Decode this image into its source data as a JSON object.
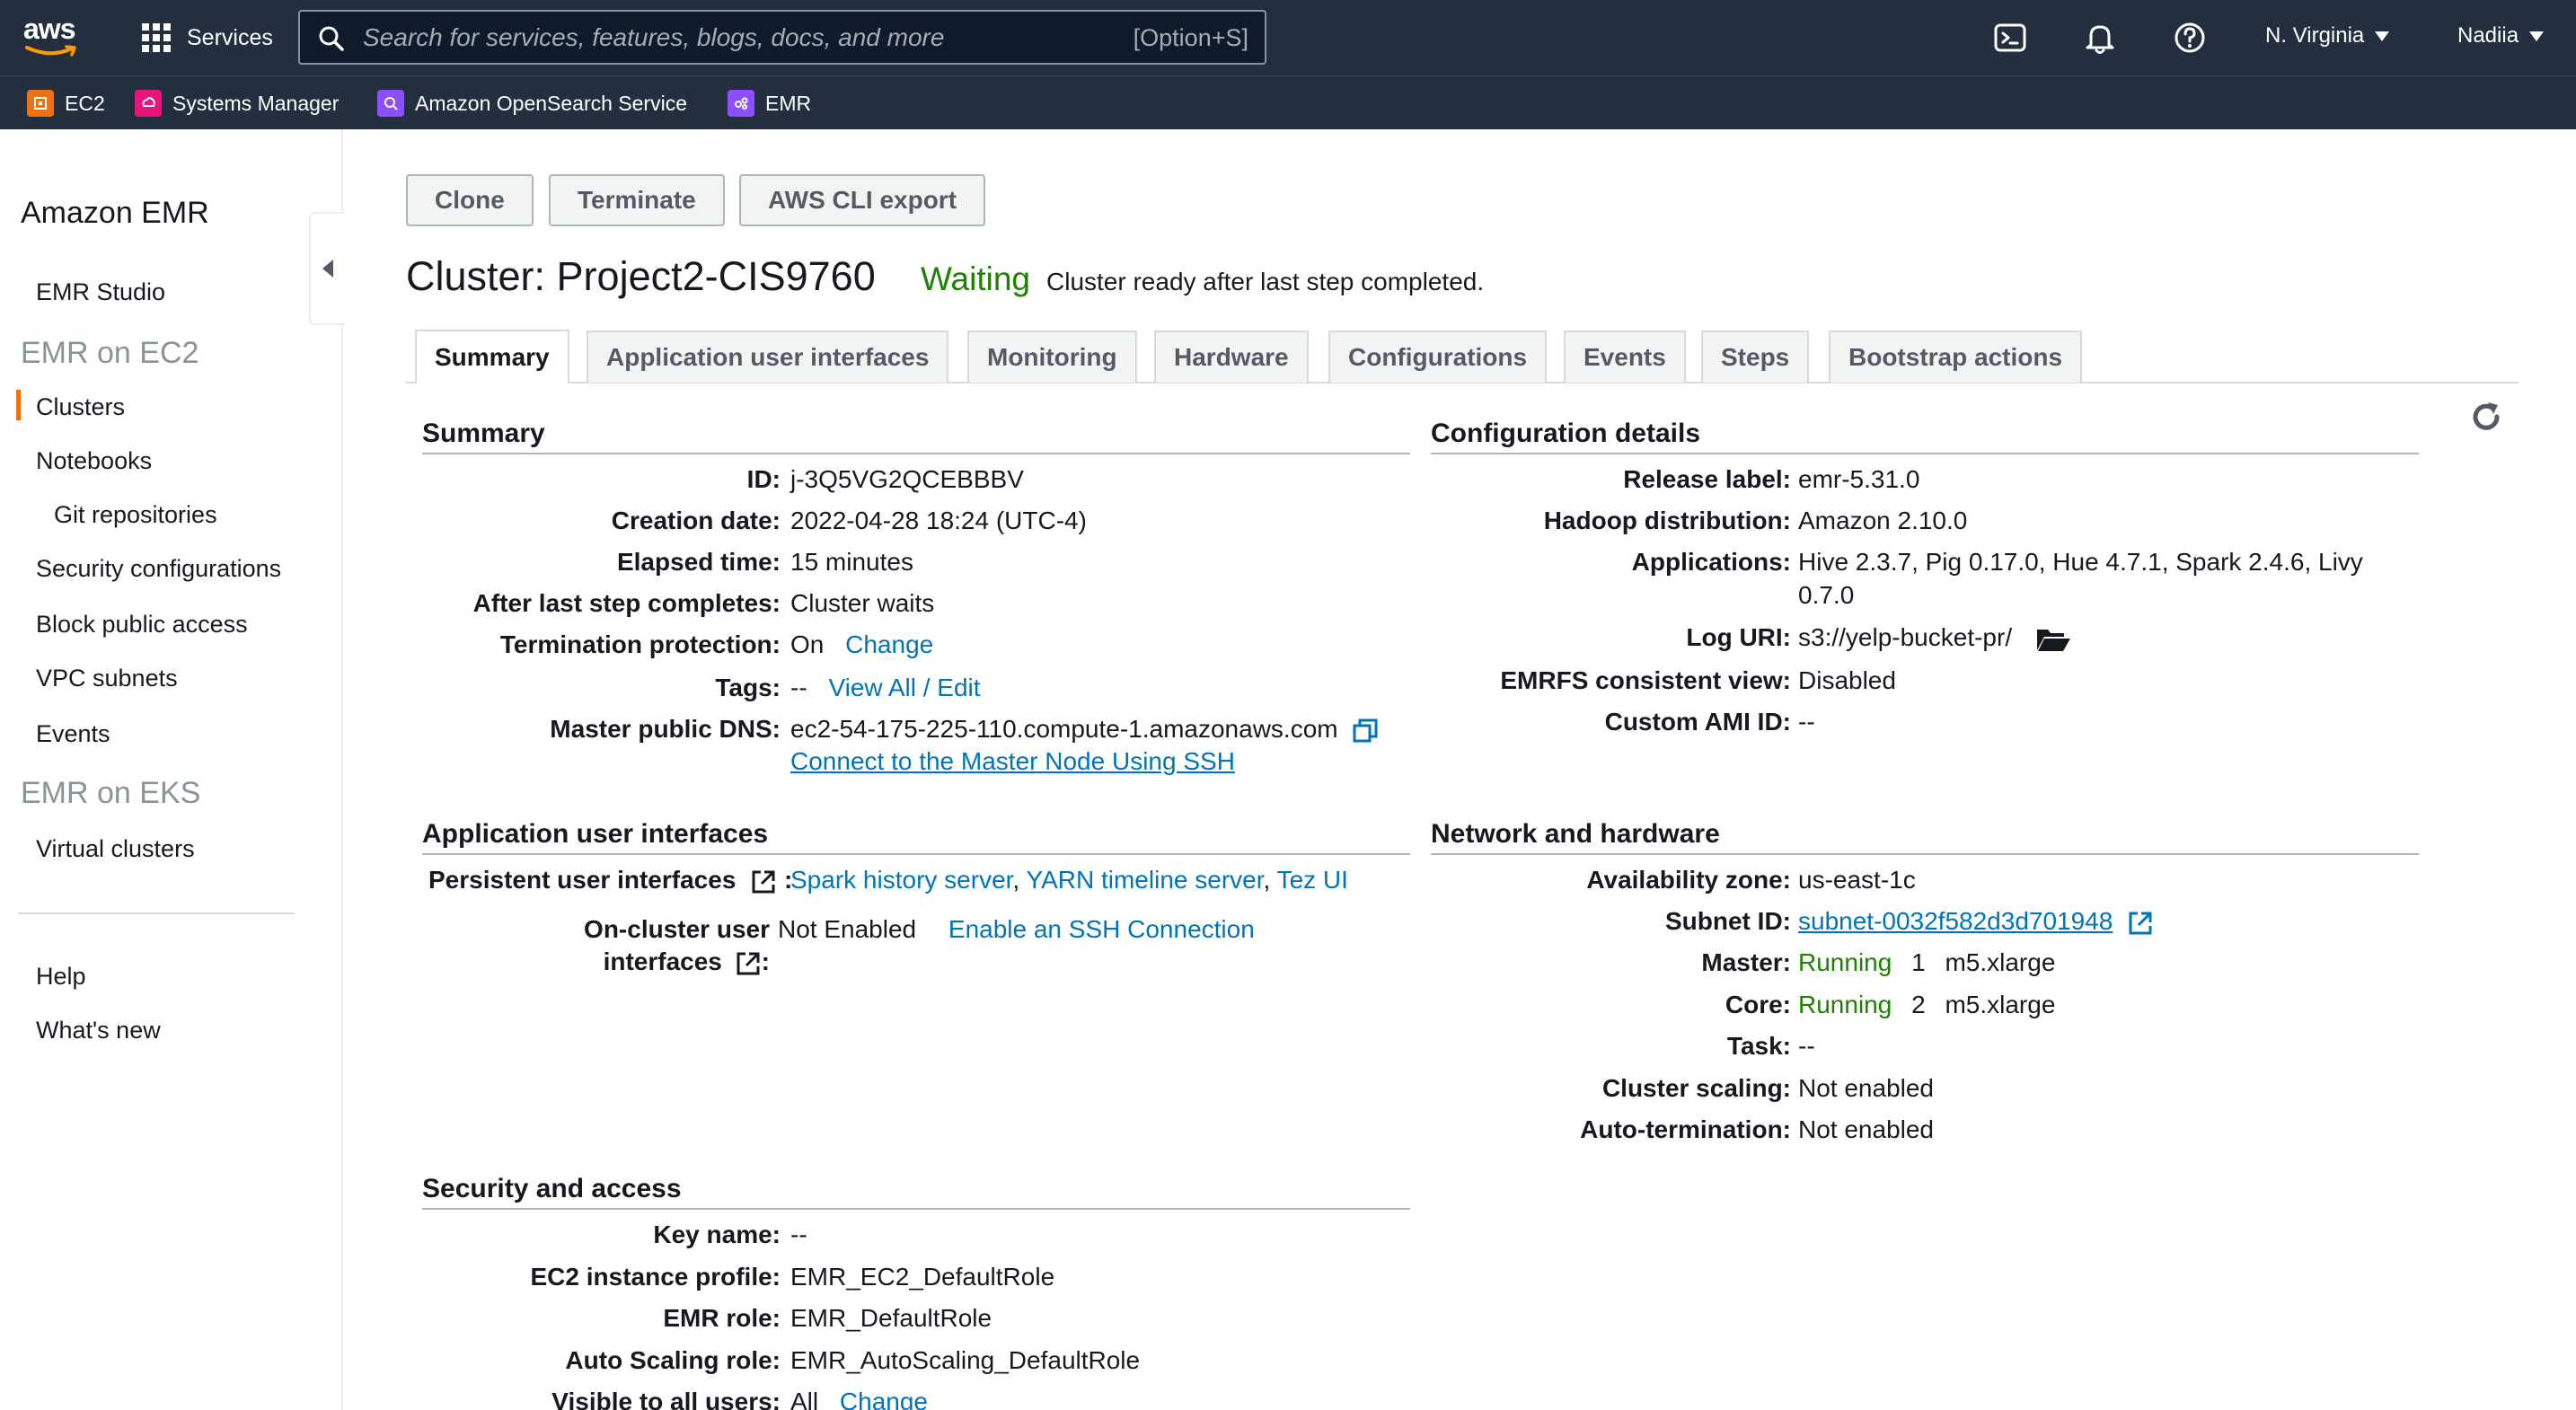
{
  "topnav": {
    "logo_text": "aws",
    "services_label": "Services",
    "search_placeholder": "Search for services, features, blogs, docs, and more",
    "search_shortcut": "[Option+S]",
    "region": "N. Virginia",
    "user": "Nadiia"
  },
  "favorites": [
    {
      "label": "EC2",
      "color": "#ec7211"
    },
    {
      "label": "Systems Manager",
      "color": "#e7157b"
    },
    {
      "label": "Amazon OpenSearch Service",
      "color": "#8c4fff"
    },
    {
      "label": "EMR",
      "color": "#8c4fff"
    }
  ],
  "sidebar": {
    "title": "Amazon EMR",
    "emr_studio": "EMR Studio",
    "section_ec2": "EMR on EC2",
    "clusters": "Clusters",
    "notebooks": "Notebooks",
    "git_repositories": "Git repositories",
    "security_configurations": "Security configurations",
    "block_public_access": "Block public access",
    "vpc_subnets": "VPC subnets",
    "events": "Events",
    "section_eks": "EMR on EKS",
    "virtual_clusters": "Virtual clusters",
    "help": "Help",
    "whats_new": "What's new"
  },
  "actions": {
    "clone": "Clone",
    "terminate": "Terminate",
    "cli_export": "AWS CLI export"
  },
  "cluster": {
    "title": "Cluster: Project2-CIS9760",
    "state": "Waiting",
    "state_message": "Cluster ready after last step completed."
  },
  "tabs": [
    "Summary",
    "Application user interfaces",
    "Monitoring",
    "Hardware",
    "Configurations",
    "Events",
    "Steps",
    "Bootstrap actions"
  ],
  "summary": {
    "title": "Summary",
    "id_label": "ID:",
    "id": "j-3Q5VG2QCEBBBV",
    "creation_label": "Creation date:",
    "creation": "2022-04-28 18:24 (UTC-4)",
    "elapsed_label": "Elapsed time:",
    "elapsed": "15 minutes",
    "after_label": "After last step completes:",
    "after": "Cluster waits",
    "termprot_label": "Termination protection:",
    "termprot": "On",
    "termprot_link": "Change",
    "tags_label": "Tags:",
    "tags": "--",
    "tags_link": "View All / Edit",
    "dns_label": "Master public DNS:",
    "dns": "ec2-54-175-225-110.compute-1.amazonaws.com",
    "ssh_link": "Connect to the Master Node Using SSH"
  },
  "config": {
    "title": "Configuration details",
    "release_label": "Release label:",
    "release": "emr-5.31.0",
    "hadoop_label": "Hadoop distribution:",
    "hadoop": "Amazon 2.10.0",
    "apps_label": "Applications:",
    "apps_line1": "Hive 2.3.7, Pig 0.17.0, Hue 4.7.1, Spark 2.4.6, Livy",
    "apps_line2": "0.7.0",
    "log_label": "Log URI:",
    "log": "s3://yelp-bucket-pr/",
    "emrfs_label": "EMRFS consistent view:",
    "emrfs": "Disabled",
    "ami_label": "Custom AMI ID:",
    "ami": "--"
  },
  "appui": {
    "title": "Application user interfaces",
    "persistent_label": "Persistent user interfaces",
    "spark": "Spark history server",
    "yarn": "YARN timeline server",
    "tez": "Tez UI",
    "sep": ",",
    "oncluster_label_1": "On-cluster user",
    "oncluster_label_2": "interfaces",
    "oncluster_value": "Not Enabled",
    "oncluster_link": "Enable an SSH Connection"
  },
  "network": {
    "title": "Network and hardware",
    "az_label": "Availability zone:",
    "az": "us-east-1c",
    "subnet_label": "Subnet ID:",
    "subnet": "subnet-0032f582d3d701948",
    "master_label": "Master:",
    "master_state": "Running",
    "master_count": "1",
    "master_type": "m5.xlarge",
    "core_label": "Core:",
    "core_state": "Running",
    "core_count": "2",
    "core_type": "m5.xlarge",
    "task_label": "Task:",
    "task": "--",
    "scaling_label": "Cluster scaling:",
    "scaling": "Not enabled",
    "autoterm_label": "Auto-termination:",
    "autoterm": "Not enabled"
  },
  "security": {
    "title": "Security and access",
    "key_label": "Key name:",
    "key": "--",
    "profile_label": "EC2 instance profile:",
    "profile": "EMR_EC2_DefaultRole",
    "role_label": "EMR role:",
    "role": "EMR_DefaultRole",
    "autoscaling_label": "Auto Scaling role:",
    "autoscaling": "EMR_AutoScaling_DefaultRole",
    "visible_label": "Visible to all users:",
    "visible": "All",
    "visible_link": "Change"
  }
}
